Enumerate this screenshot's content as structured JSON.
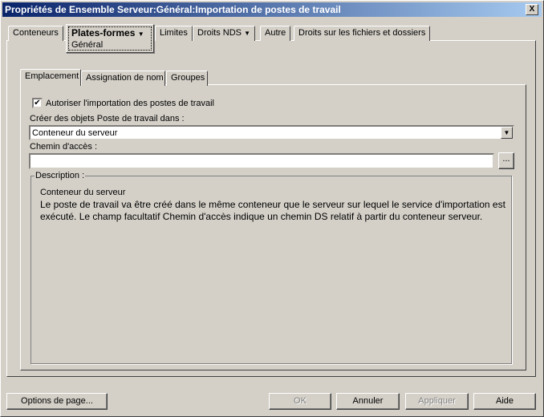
{
  "window": {
    "title": "Propriétés de Ensemble Serveur:Général:Importation de postes de travail",
    "close": "X"
  },
  "tabs": [
    {
      "label": "Conteneurs"
    },
    {
      "label": "Plates-formes",
      "dropdown": true,
      "selected": true,
      "sub": "Général"
    },
    {
      "label": "Limites"
    },
    {
      "label": "Droits NDS",
      "dropdown": true
    },
    {
      "label": "Autre"
    },
    {
      "label": "Droits sur les fichiers et dossiers"
    }
  ],
  "subtabs": [
    {
      "label": "Emplacement",
      "selected": true
    },
    {
      "label": "Assignation de nom"
    },
    {
      "label": "Groupes"
    }
  ],
  "form": {
    "checkbox_label": "Autoriser l'importation des postes de travail",
    "checked": true,
    "create_label": "Créer des objets Poste de travail dans :",
    "create_value": "Conteneur du serveur",
    "path_label": "Chemin d'accès :",
    "path_value": "",
    "browse": "...",
    "desc_title": "Description :",
    "desc_heading": "Conteneur du serveur",
    "desc_text": "Le poste de travail va être créé dans le même conteneur que le serveur sur lequel le service d'importation est exécuté. Le champ facultatif Chemin d'accès indique un chemin DS relatif à partir du conteneur serveur."
  },
  "buttons": {
    "options": "Options de page...",
    "ok": "OK",
    "cancel": "Annuler",
    "apply": "Appliquer",
    "help": "Aide"
  }
}
